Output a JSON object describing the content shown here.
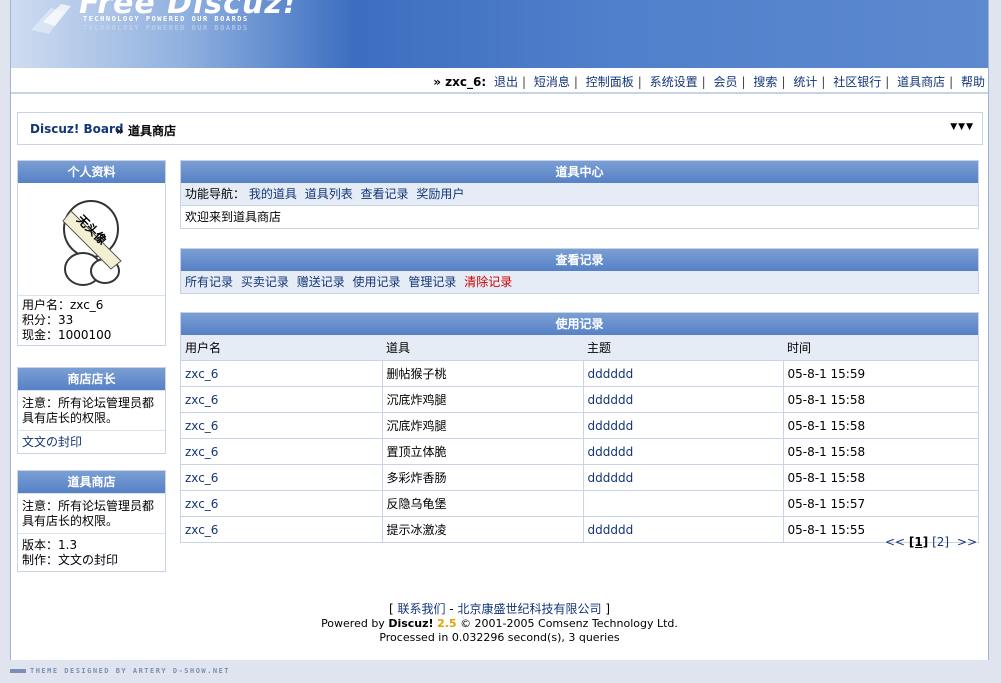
{
  "header": {
    "logo_text": "Free Discuz!",
    "tagline": "TECHNOLOGY POWERED OUR BOARDS"
  },
  "topnav": {
    "user": "» zxc_6:",
    "links": [
      "退出",
      "短消息",
      "控制面板",
      "系统设置",
      "会员",
      "搜索",
      "统计",
      "社区银行",
      "道具商店",
      "帮助"
    ]
  },
  "breadcrumb": {
    "root": "Discuz! Board",
    "separator": "»",
    "current": "道具商店",
    "arrows": "▼▼▼"
  },
  "profile": {
    "title": "个人资料",
    "avatar_text": "无头像",
    "username": "用户名：zxc_6",
    "points": "积分：33",
    "cash": "现金：1000100"
  },
  "shopkeeper": {
    "title": "商店店长",
    "note": "注意：所有论坛管理员都具有店长的权限。",
    "owner": "文文の封印"
  },
  "shop": {
    "title": "道具商店",
    "note": "注意：所有论坛管理员都具有店长的权限。",
    "version": "版本：1.3",
    "author": "制作：文文の封印"
  },
  "center": {
    "title": "道具中心",
    "nav_label": "功能导航：",
    "nav_links": [
      "我的道具",
      "道具列表",
      "查看记录",
      "奖励用户"
    ],
    "welcome": "欢迎来到道具商店"
  },
  "records_nav": {
    "title": "查看记录",
    "links": [
      "所有记录",
      "买卖记录",
      "赠送记录",
      "使用记录",
      "管理记录"
    ],
    "clear": "清除记录"
  },
  "usage": {
    "title": "使用记录",
    "headers": [
      "用户名",
      "道具",
      "主题",
      "时间"
    ],
    "rows": [
      [
        "zxc_6",
        "删帖猴子桃",
        "dddddd",
        "05-8-1 15:59"
      ],
      [
        "zxc_6",
        "沉底炸鸡腿",
        "dddddd",
        "05-8-1 15:58"
      ],
      [
        "zxc_6",
        "沉底炸鸡腿",
        "dddddd",
        "05-8-1 15:58"
      ],
      [
        "zxc_6",
        "置顶立体脆",
        "dddddd",
        "05-8-1 15:58"
      ],
      [
        "zxc_6",
        "多彩炸香肠",
        "dddddd",
        "05-8-1 15:58"
      ],
      [
        "zxc_6",
        "反隐乌龟堡",
        "",
        "05-8-1 15:57"
      ],
      [
        "zxc_6",
        "提示冰激凌",
        "dddddd",
        "05-8-1 15:55"
      ]
    ]
  },
  "pager": {
    "prev": "<<",
    "current": "[1]",
    "next_page": "[2]",
    "next": ">>"
  },
  "footer": {
    "contact_open": "[ ",
    "contact": "联系我们",
    "dash": " - ",
    "company": "北京康盛世纪科技有限公司",
    "contact_close": " ]",
    "powered_prefix": "Powered by ",
    "product": "Discuz!",
    "version": "2.5",
    "copyright": "© 2001-2005 Comsenz Technology Ltd.",
    "processed": "Processed in 0.032296 second(s), 3 queries"
  },
  "bottom": {
    "theme_credit": "THEME DESIGNED BY ARTERY D-SHOW.NET"
  }
}
